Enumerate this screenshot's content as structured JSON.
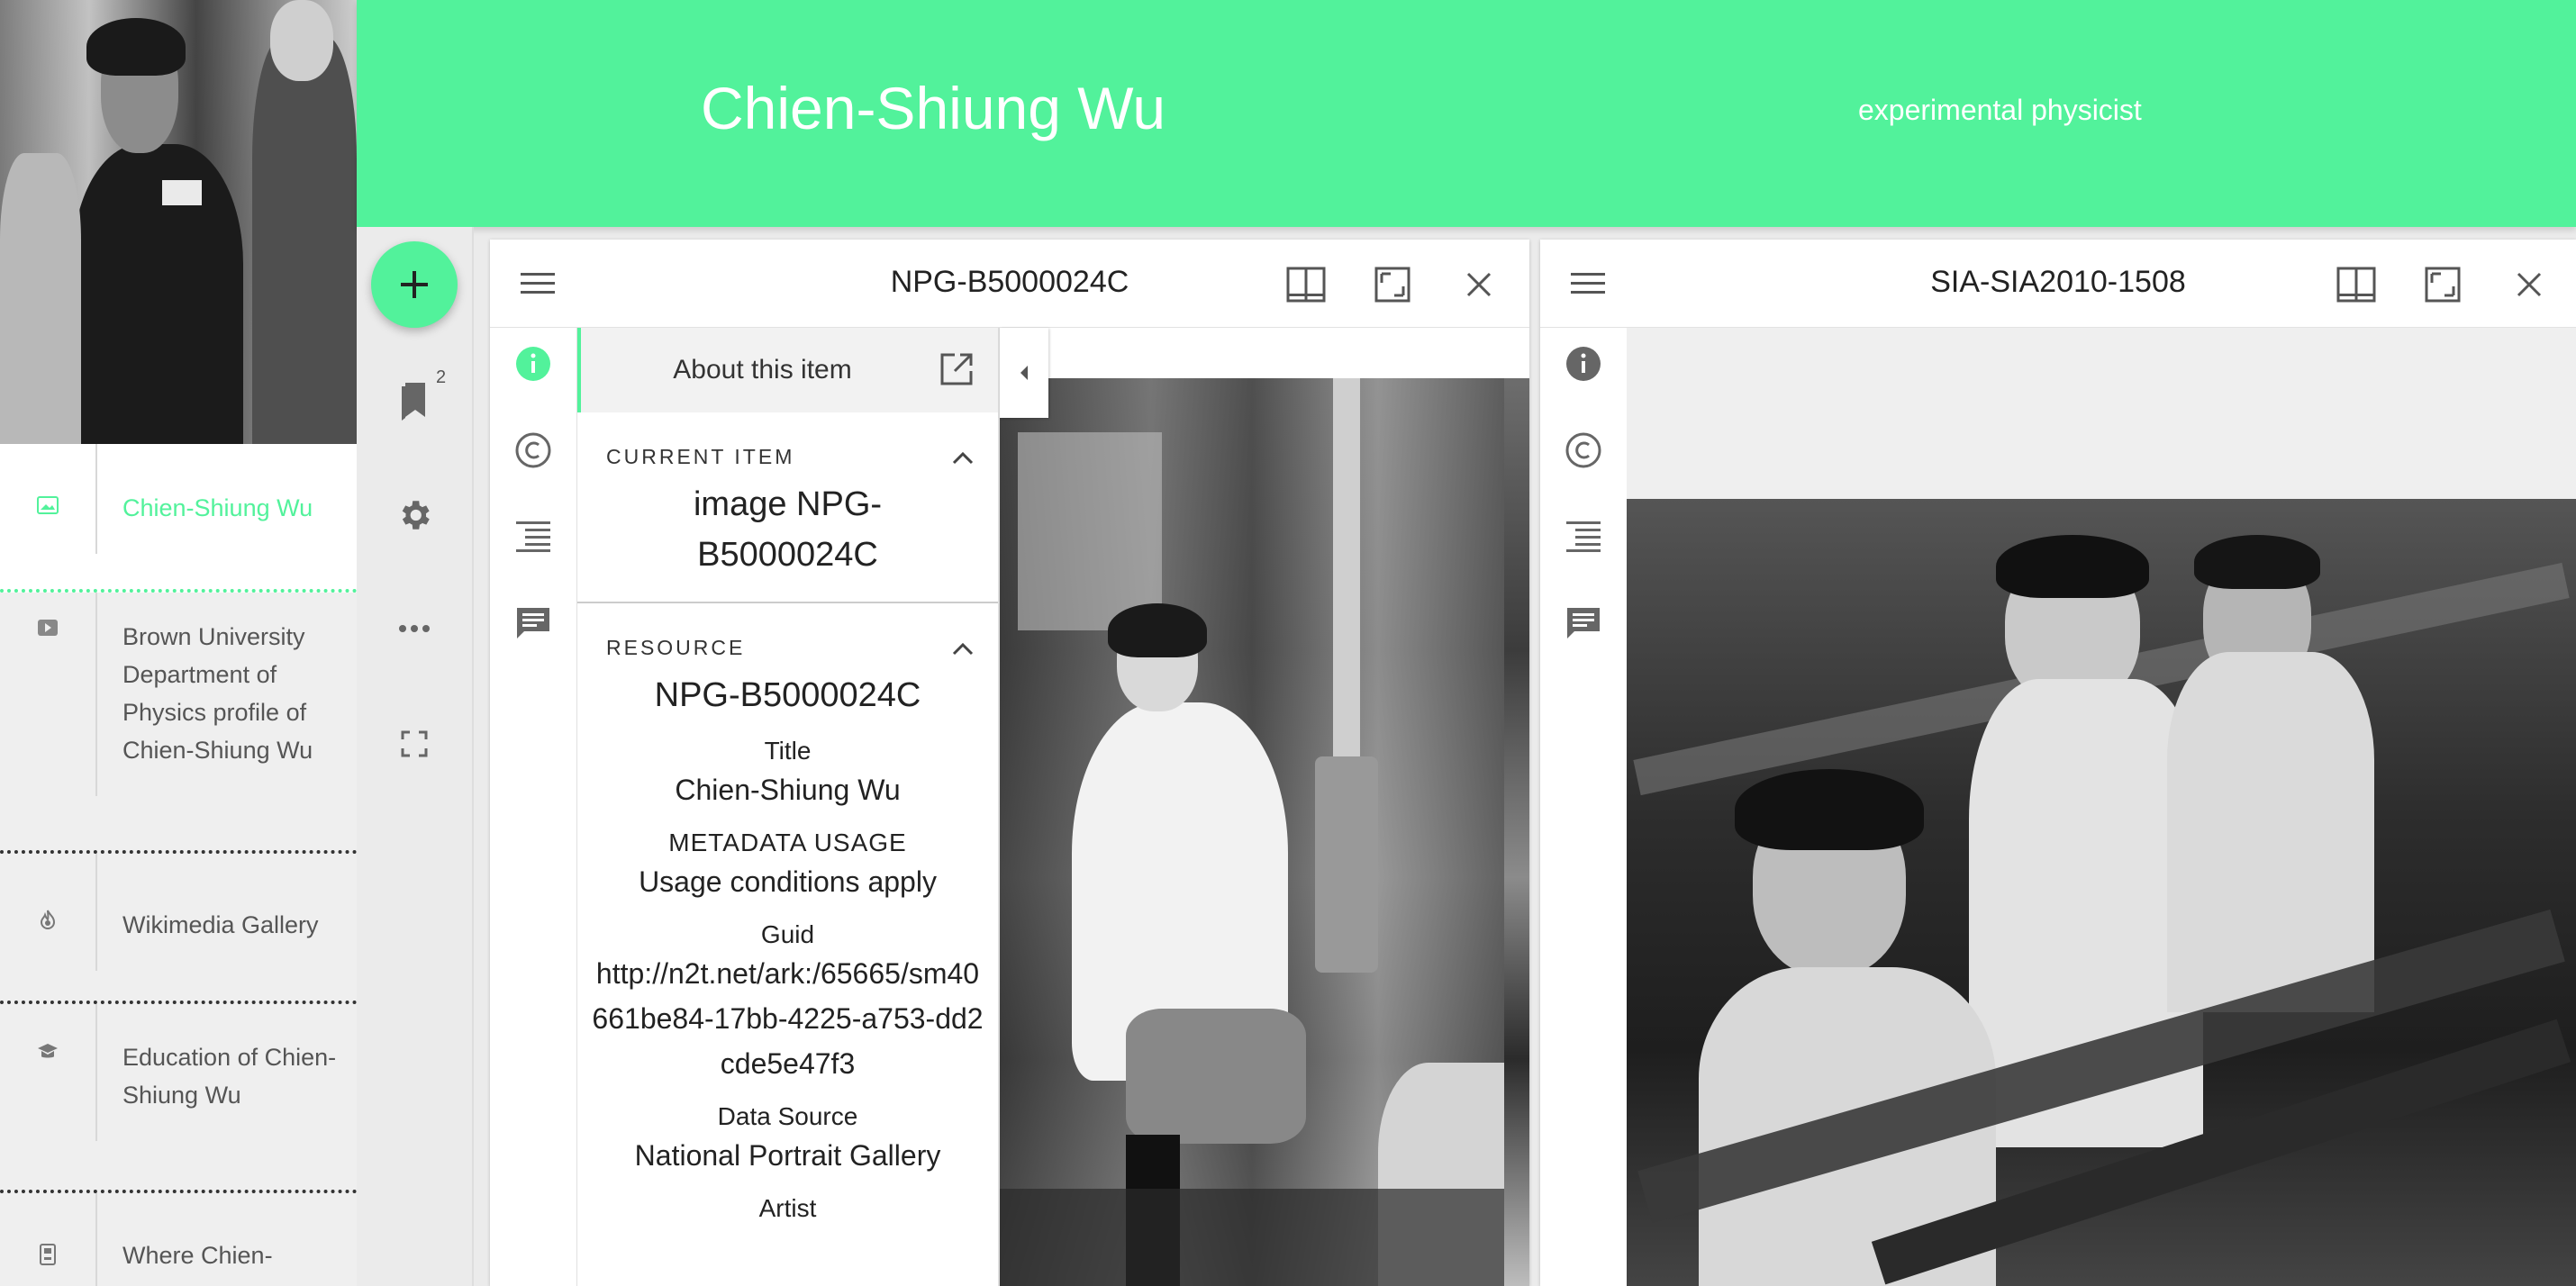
{
  "header": {
    "title": "Chien-Shiung Wu",
    "subtitle": "experimental physicist",
    "accent_color": "#52f29b"
  },
  "sidebar": {
    "items": [
      {
        "icon": "image-icon",
        "label": "Chien-Shiung Wu",
        "active": true
      },
      {
        "icon": "video-icon",
        "label": "Brown University Department of Physics profile of Chien-Shiung Wu",
        "active": false
      },
      {
        "icon": "fire-icon",
        "label": "Wikimedia Gallery",
        "active": false
      },
      {
        "icon": "graduation-cap-icon",
        "label": "Education of Chien-Shiung Wu",
        "active": false
      },
      {
        "icon": "building-icon",
        "label": "Where Chien-",
        "active": false
      }
    ]
  },
  "rail": {
    "add_icon": "plus-icon",
    "bookmark_count": "2",
    "icons": [
      "bookmark-icon",
      "gear-icon",
      "more-horizontal-icon",
      "fullscreen-icon"
    ]
  },
  "windows": [
    {
      "title": "NPG-B5000024C",
      "panel": {
        "about_label": "About this item",
        "current_item_heading": "CURRENT ITEM",
        "current_item_value": "image NPG-B5000024C",
        "resource_heading": "RESOURCE",
        "resource_value": "NPG-B5000024C",
        "metadata": [
          {
            "label": "Title",
            "value": "Chien-Shiung Wu"
          },
          {
            "label": "METADATA USAGE",
            "value": "Usage conditions apply"
          },
          {
            "label": "Guid",
            "value": "http://n2t.net/ark:/65665/sm40661be84-17bb-4225-a753-dd2cde5e47f3"
          },
          {
            "label": "Data Source",
            "value": "National Portrait Gallery"
          },
          {
            "label": "Artist",
            "value": ""
          }
        ]
      }
    },
    {
      "title": "SIA-SIA2010-1508"
    }
  ]
}
